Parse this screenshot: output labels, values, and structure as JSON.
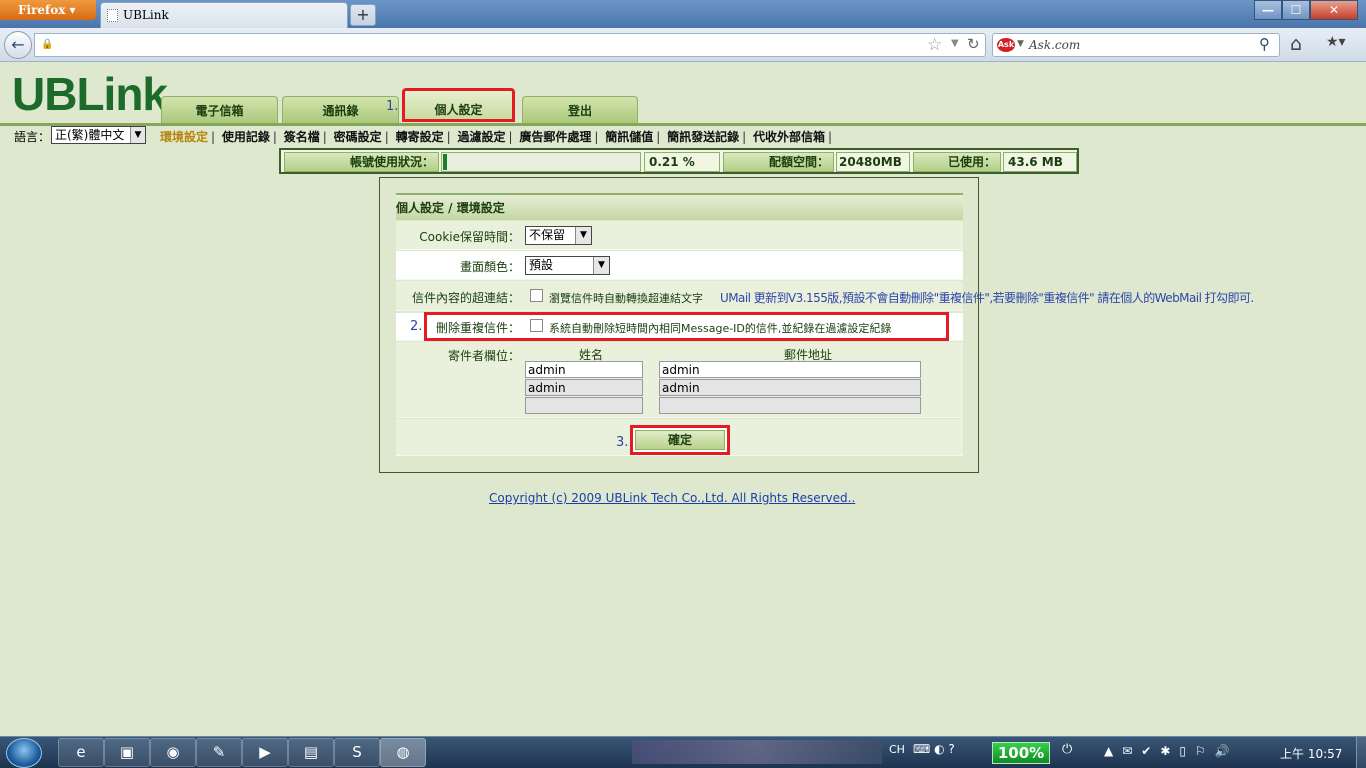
{
  "browser": {
    "app_button": "Firefox",
    "tab_title": "UBLink",
    "new_tab": "+",
    "window_controls": {
      "minimize": "—",
      "maximize": "☐",
      "close": "✕"
    },
    "search_placeholder": "Ask.com",
    "search_logo": "Ask"
  },
  "page": {
    "logo": "UBLink",
    "main_tabs": {
      "mail": "電子信箱",
      "contacts": "通訊錄",
      "personal": "個人設定",
      "logout": "登出"
    },
    "steps": {
      "one": "1.",
      "two": "2.",
      "three": "3."
    },
    "language_label": "語言：",
    "language_value": "正(繁)體中文",
    "sub_nav": [
      "環境設定",
      "使用記錄",
      "簽名檔",
      "密碼設定",
      "轉寄設定",
      "過濾設定",
      "廣告郵件處理",
      "簡訊儲值",
      "簡訊發送記錄",
      "代收外部信箱"
    ],
    "usage": {
      "label": "帳號使用狀況：",
      "percent": "0.21 %",
      "percent_value": 0.21,
      "quota_label": "配額空間：",
      "quota": "20480MB",
      "used_label": "已使用：",
      "used": "43.6 MB"
    },
    "panel": {
      "title": "個人設定 / 環境設定",
      "cookie_label": "Cookie保留時間：",
      "cookie_value": "不保留",
      "color_label": "畫面顏色：",
      "color_value": "預設",
      "hyperlink_label": "信件內容的超連結：",
      "hyperlink_option": "瀏覽信件時自動轉換超連結文字",
      "hyperlink_note": "UMail 更新到V3.155版,預設不會自動刪除\"重複信件\",若要刪除\"重複信件\" 請在個人的WebMail 打勾即可.",
      "dup_label": "刪除重複信件：",
      "dup_option": "系統自動刪除短時間內相同Message-ID的信件,並紀錄在過濾設定紀錄",
      "sender_label": "寄件者欄位：",
      "col_name": "姓名",
      "col_email": "郵件地址",
      "senders": [
        {
          "name": "admin",
          "email": "admin"
        },
        {
          "name": "admin",
          "email": "admin"
        },
        {
          "name": "",
          "email": ""
        }
      ],
      "confirm": "確定"
    },
    "copyright": "Copyright (c) 2009 UBLink Tech Co.,Ltd. All Rights Reserved.."
  },
  "taskbar": {
    "lang": "CH",
    "battery": "100%",
    "clock": "上午 10:57"
  },
  "colors": {
    "page_bg": "#dde8cf",
    "brand_green": "#1d6b2a",
    "highlight_red": "#e31b23",
    "link_blue": "#1b3ea8",
    "note_blue": "#3145a8"
  }
}
